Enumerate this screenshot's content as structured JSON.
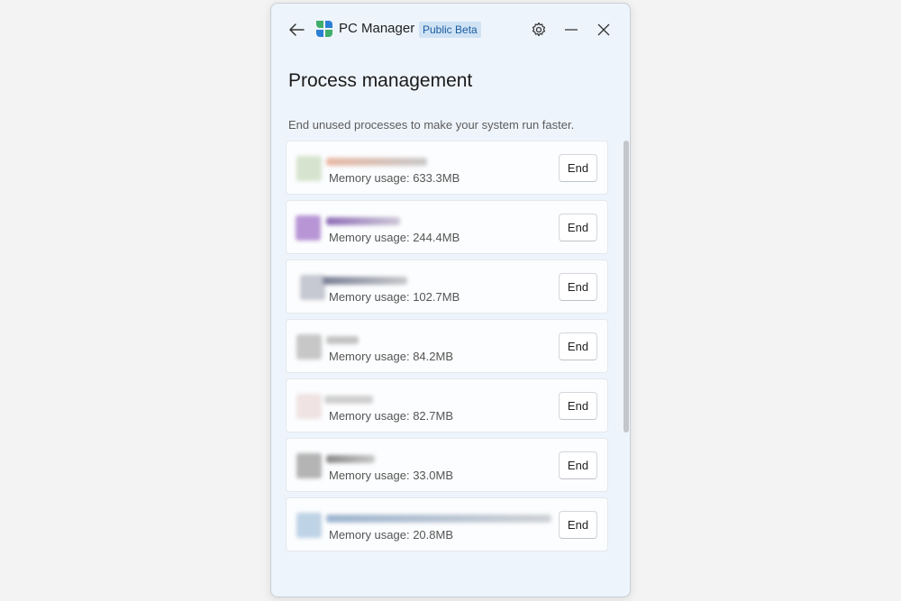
{
  "app": {
    "title": "PC Manager",
    "badge": "Public Beta"
  },
  "page": {
    "title": "Process management",
    "description": "End unused processes to make your system run faster."
  },
  "processes": [
    {
      "memory_label": "Memory usage: 633.3MB",
      "end_label": "End",
      "icon_color": "#cfe0c8"
    },
    {
      "memory_label": "Memory usage: 244.4MB",
      "end_label": "End",
      "icon_color": "#b896d6"
    },
    {
      "memory_label": "Memory usage: 102.7MB",
      "end_label": "End",
      "icon_color": "#c6c8d2"
    },
    {
      "memory_label": "Memory usage: 84.2MB",
      "end_label": "End",
      "icon_color": "#c7c7c7"
    },
    {
      "memory_label": "Memory usage: 82.7MB",
      "end_label": "End",
      "icon_color": "#efe3e3"
    },
    {
      "memory_label": "Memory usage: 33.0MB",
      "end_label": "End",
      "icon_color": "#b4b4b4"
    },
    {
      "memory_label": "Memory usage: 20.8MB",
      "end_label": "End",
      "icon_color": "#bfd3e6"
    }
  ],
  "icons": {
    "back": "back-arrow-icon",
    "logo": "pc-manager-logo",
    "settings": "gear-icon",
    "minimize": "minimize-icon",
    "close": "close-icon"
  },
  "colors": {
    "window_bg": "#eef4fb",
    "badge_bg": "#cfe3f5",
    "badge_text": "#1b5c9e",
    "logo_green": "#3fae6a",
    "logo_blue": "#2b7fd4"
  }
}
